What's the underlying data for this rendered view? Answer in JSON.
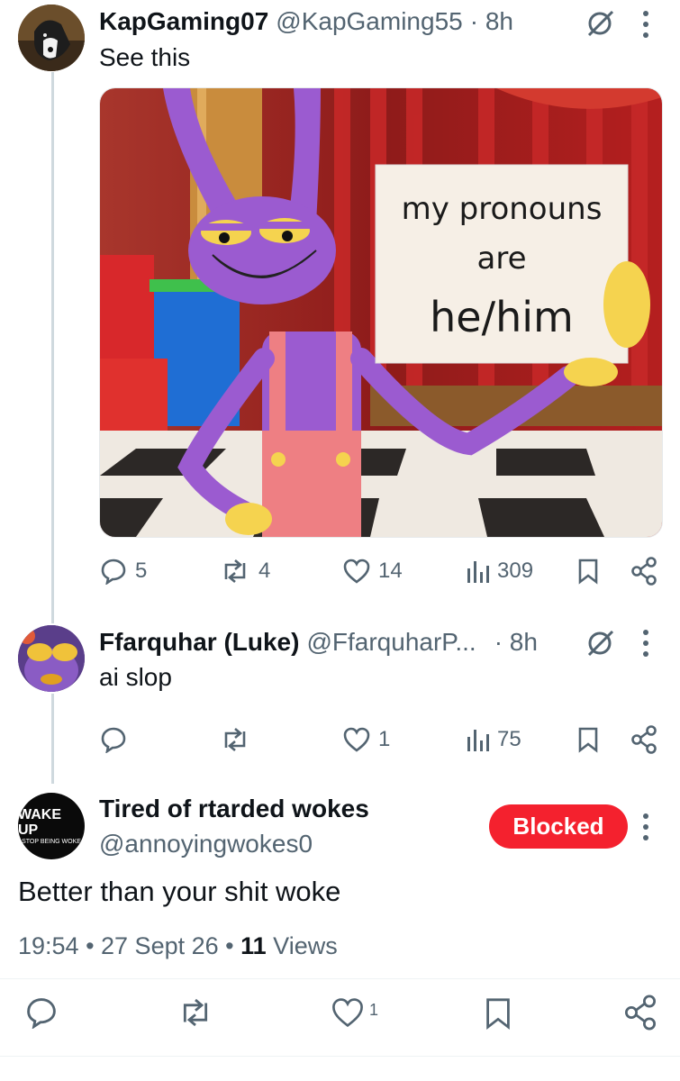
{
  "tweet1": {
    "display_name": "KapGaming07",
    "handle": "@KapGaming55",
    "time": "· 8h",
    "text": "See this",
    "media": {
      "sign_line1": "my pronouns",
      "sign_line2": "are",
      "sign_line3": "he/him"
    },
    "actions": {
      "replies": "5",
      "reposts": "4",
      "likes": "14",
      "views": "309"
    }
  },
  "tweet2": {
    "display_name": "Ffarquhar (Luke)",
    "handle": "@FfarquharP...",
    "time": "· 8h",
    "text": "ai slop",
    "actions": {
      "replies": "",
      "reposts": "",
      "likes": "1",
      "views": "75"
    }
  },
  "tweet3": {
    "display_name": "Tired of rtarded wokes",
    "handle": "@annoyingwokes0",
    "avatar_line1": "WAKE UP",
    "avatar_line2": "STOP BEING WOKE",
    "blocked_label": "Blocked",
    "text": "Better than your shit woke",
    "timestamp": "19:54 • 27 Sept 26 •",
    "views_count": "11",
    "views_label": "Views",
    "actions": {
      "likes": "1"
    }
  },
  "colors": {
    "text_primary": "#0f1419",
    "text_secondary": "#536471",
    "blocked_red": "#f4212e",
    "thread_line": "#cfd9de"
  }
}
